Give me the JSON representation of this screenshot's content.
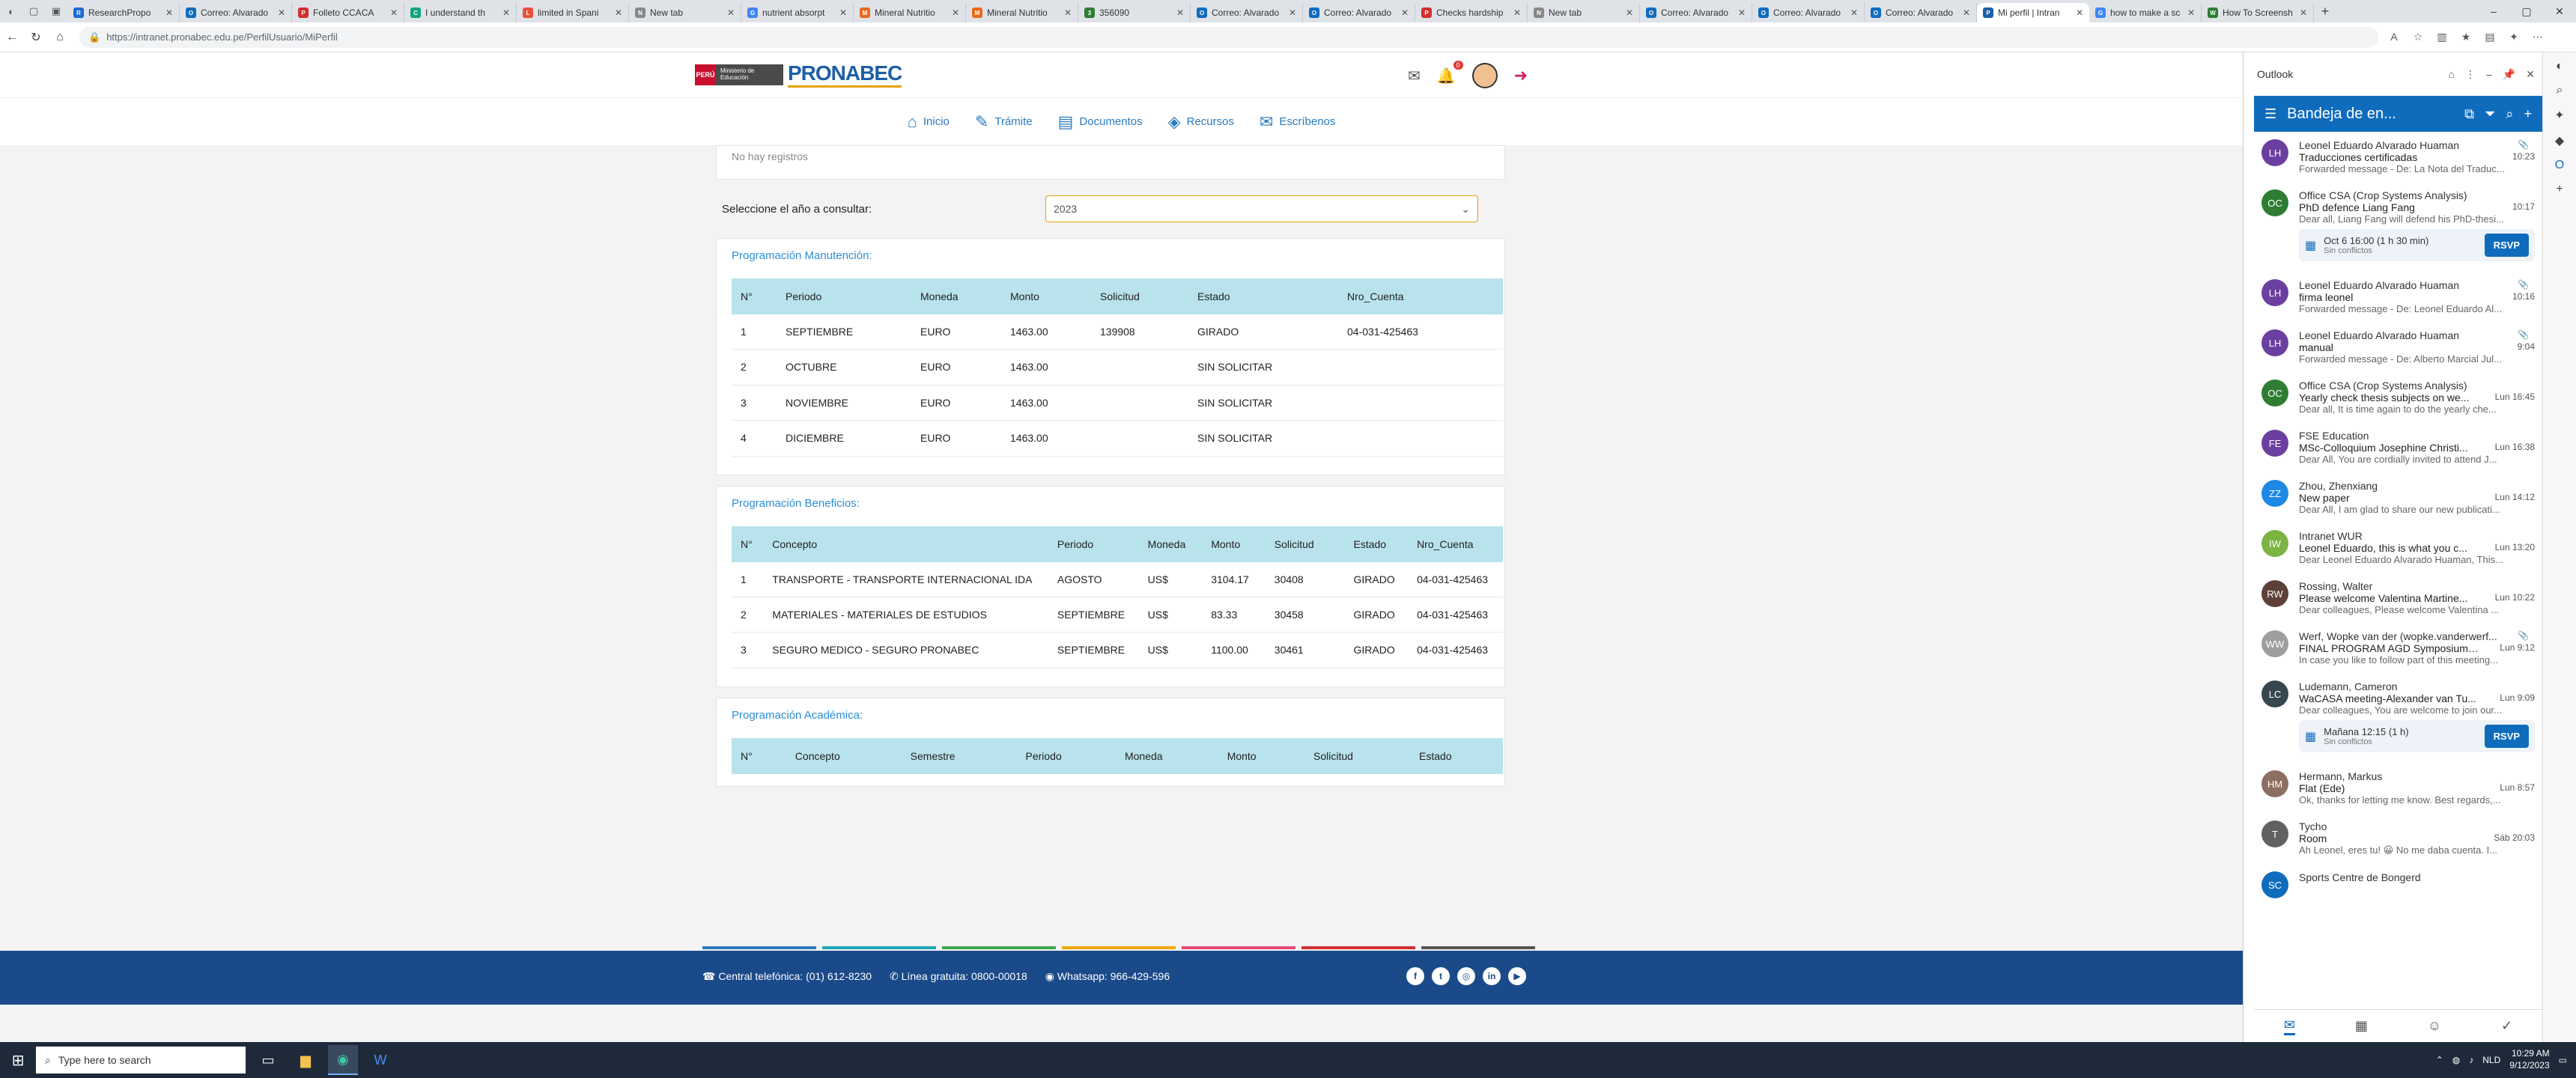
{
  "browser": {
    "tabs": [
      {
        "title": "ResearchPropo",
        "color": "#1d6ad6",
        "icon": "R"
      },
      {
        "title": "Correo: Alvarado",
        "color": "#0f6cbd",
        "icon": "O"
      },
      {
        "title": "Folleto CCACA",
        "color": "#d32f2f",
        "icon": "P"
      },
      {
        "title": "I understand th",
        "color": "#10a37f",
        "icon": "C"
      },
      {
        "title": "limited in Spani",
        "color": "#e8503a",
        "icon": "L"
      },
      {
        "title": "New tab",
        "color": "#888888",
        "icon": "N"
      },
      {
        "title": "nutrient absorpt",
        "color": "#4285f4",
        "icon": "G"
      },
      {
        "title": "Mineral Nutritio",
        "color": "#e86a1a",
        "icon": "M"
      },
      {
        "title": "Mineral Nutritio",
        "color": "#e86a1a",
        "icon": "M"
      },
      {
        "title": "356090",
        "color": "#2e7d32",
        "icon": "3"
      },
      {
        "title": "Correo: Alvarado",
        "color": "#0f6cbd",
        "icon": "O"
      },
      {
        "title": "Correo: Alvarado",
        "color": "#0f6cbd",
        "icon": "O"
      },
      {
        "title": "Checks hardship",
        "color": "#d32f2f",
        "icon": "P"
      },
      {
        "title": "New tab",
        "color": "#888888",
        "icon": "N"
      },
      {
        "title": "Correo: Alvarado",
        "color": "#0f6cbd",
        "icon": "O"
      },
      {
        "title": "Correo: Alvarado",
        "color": "#0f6cbd",
        "icon": "O"
      },
      {
        "title": "Correo: Alvarado",
        "color": "#0f6cbd",
        "icon": "O"
      },
      {
        "title": "Mi perfil | Intran",
        "color": "#1d5fa7",
        "icon": "P",
        "active": true
      },
      {
        "title": "how to make a sc",
        "color": "#4285f4",
        "icon": "G"
      },
      {
        "title": "How To Screensh",
        "color": "#2e7d32",
        "icon": "W"
      }
    ],
    "url": "https://intranet.pronabec.edu.pe/PerfilUsuario/MiPerfil"
  },
  "site": {
    "peru_label": "PERÚ",
    "ministry_label": "Ministerio de Educación",
    "brand": "PRONABEC",
    "notif_count": "0",
    "nav": [
      {
        "label": "Inicio",
        "icon": "home-icon",
        "glyph": "⌂"
      },
      {
        "label": "Trámite",
        "icon": "form-icon",
        "glyph": "✎"
      },
      {
        "label": "Documentos",
        "icon": "document-icon",
        "glyph": "▤"
      },
      {
        "label": "Recursos",
        "icon": "resources-icon",
        "glyph": "◈"
      },
      {
        "label": "Escríbenos",
        "icon": "chat-icon",
        "glyph": "✉"
      }
    ]
  },
  "content": {
    "no_records": "No hay registros",
    "year_label": "Seleccione el año a consultar:",
    "year_value": "2023",
    "manutencion": {
      "title": "Programación Manutención:",
      "headers": [
        "N°",
        "Periodo",
        "Moneda",
        "Monto",
        "Solicitud",
        "Estado",
        "Nro_Cuenta"
      ],
      "rows": [
        [
          "1",
          "SEPTIEMBRE",
          "EURO",
          "1463.00",
          "139908",
          "GIRADO",
          "04-031-425463"
        ],
        [
          "2",
          "OCTUBRE",
          "EURO",
          "1463.00",
          "",
          "SIN SOLICITAR",
          ""
        ],
        [
          "3",
          "NOVIEMBRE",
          "EURO",
          "1463.00",
          "",
          "SIN SOLICITAR",
          ""
        ],
        [
          "4",
          "DICIEMBRE",
          "EURO",
          "1463.00",
          "",
          "SIN SOLICITAR",
          ""
        ]
      ]
    },
    "beneficios": {
      "title": "Programación Beneficios:",
      "headers": [
        "N°",
        "Concepto",
        "Periodo",
        "Moneda",
        "Monto",
        "Solicitud",
        "Estado",
        "Nro_Cuenta"
      ],
      "rows": [
        [
          "1",
          "TRANSPORTE - TRANSPORTE INTERNACIONAL IDA",
          "AGOSTO",
          "US$",
          "3104.17",
          "30408",
          "GIRADO",
          "04-031-425463"
        ],
        [
          "2",
          "MATERIALES - MATERIALES DE ESTUDIOS",
          "SEPTIEMBRE",
          "US$",
          "83.33",
          "30458",
          "GIRADO",
          "04-031-425463"
        ],
        [
          "3",
          "SEGURO MEDICO - SEGURO PRONABEC",
          "SEPTIEMBRE",
          "US$",
          "1100.00",
          "30461",
          "GIRADO",
          "04-031-425463"
        ]
      ]
    },
    "academica": {
      "title": "Programación Académica:",
      "headers": [
        "N°",
        "Concepto",
        "Semestre",
        "Periodo",
        "Moneda",
        "Monto",
        "Solicitud",
        "Estado"
      ]
    }
  },
  "footer": {
    "central_label": "Central telefónica:",
    "central_value": "(01)  612-8230",
    "line_label": "Línea gratuita: 0800-00018",
    "whatsapp": "Whatsapp: 966-429-596",
    "stripe_colors": [
      "#2b7bbf",
      "#1fa6b8",
      "#3aa84a",
      "#f2a900",
      "#e8467c",
      "#d32f2f",
      "#555555"
    ]
  },
  "outlook": {
    "app_title": "Outlook",
    "folder": "Bandeja de en...",
    "emails": [
      {
        "initials": "LH",
        "color": "#6b3fa0",
        "sender": "Leonel Eduardo Alvarado Huaman",
        "subject": "Traducciones certificadas",
        "time": "10:23",
        "preview": "Forwarded message - De: La Nota del Traduc...",
        "clip": true
      },
      {
        "initials": "OC",
        "color": "#2e7d32",
        "sender": "Office CSA (Crop Systems Analysis)",
        "subject": "PhD defence Liang Fang",
        "time": "10:17",
        "preview": "Dear all, Liang Fang will defend his PhD-thesi...",
        "rsvp": {
          "text": "Oct 6 16:00 (1 h 30 min)",
          "sub": "Sin conflictos",
          "btn": "RSVP"
        }
      },
      {
        "initials": "LH",
        "color": "#6b3fa0",
        "sender": "Leonel Eduardo Alvarado Huaman",
        "subject": "firma leonel",
        "time": "10:16",
        "preview": "Forwarded message - De: Leonel Eduardo Al...",
        "clip": true
      },
      {
        "initials": "LH",
        "color": "#6b3fa0",
        "sender": "Leonel Eduardo Alvarado Huaman",
        "subject": "manual",
        "time": "9:04",
        "preview": "Forwarded message - De: Alberto Marcial Jul...",
        "clip": true
      },
      {
        "initials": "OC",
        "color": "#2e7d32",
        "sender": "Office CSA (Crop Systems Analysis)",
        "subject": "Yearly check thesis subjects on we...",
        "time": "Lun 16:45",
        "preview": "Dear all, It is time again to do the yearly che..."
      },
      {
        "initials": "FE",
        "color": "#6b3fa0",
        "sender": "FSE Education",
        "subject": "MSc-Colloquium Josephine Christi...",
        "time": "Lun 16:38",
        "preview": "Dear All, You are cordially invited to attend J..."
      },
      {
        "initials": "ZZ",
        "color": "#1e88e5",
        "sender": "Zhou, Zhenxiang",
        "subject": "New paper",
        "time": "Lun 14:12",
        "preview": "Dear All, I am glad to share our new publicati..."
      },
      {
        "initials": "IW",
        "color": "#7cb342",
        "sender": "Intranet WUR",
        "subject": "Leonel Eduardo, this is what you c...",
        "time": "Lun 13:20",
        "preview": "Dear Leonel Eduardo Alvarado Huaman, This..."
      },
      {
        "initials": "RW",
        "color": "#5d4037",
        "sender": "Rossing, Walter",
        "subject": "Please welcome Valentina Martine...",
        "time": "Lun 10:22",
        "preview": "Dear colleagues, Please welcome Valentina ..."
      },
      {
        "initials": "WW",
        "color": "#9e9e9e",
        "sender": "Werf, Wopke van der (wopke.vanderwerf...",
        "subject": "FINAL PROGRAM AGD Symposium ...",
        "time": "Lun 9:12",
        "preview": "In case you like to follow part of this meeting...",
        "clip": true
      },
      {
        "initials": "LC",
        "color": "#37474f",
        "sender": "Ludemann, Cameron",
        "subject": "WaCASA meeting-Alexander van Tu...",
        "time": "Lun 9:09",
        "preview": "Dear colleagues, You are welcome to join our...",
        "rsvp": {
          "text": "Mañana 12:15 (1 h)",
          "sub": "Sin conflictos",
          "btn": "RSVP"
        }
      },
      {
        "initials": "HM",
        "color": "#8d6e63",
        "sender": "Hermann, Markus",
        "subject": "Flat (Ede)",
        "time": "Lun 8:57",
        "preview": "Ok, thanks for letting me know. Best regards,..."
      },
      {
        "initials": "T",
        "color": "#616161",
        "sender": "Tycho",
        "subject": "Room",
        "time": "Sáb 20:03",
        "preview": "Ah Leonel, eres tu! 😀 No me daba cuenta. I..."
      },
      {
        "initials": "SC",
        "color": "#0f6cbd",
        "sender": "Sports Centre de Bongerd",
        "subject": "",
        "time": "",
        "preview": ""
      }
    ]
  },
  "taskbar": {
    "search_placeholder": "Type here to search",
    "time": "10:29 AM",
    "date": "9/12/2023",
    "lang": "NLD"
  }
}
